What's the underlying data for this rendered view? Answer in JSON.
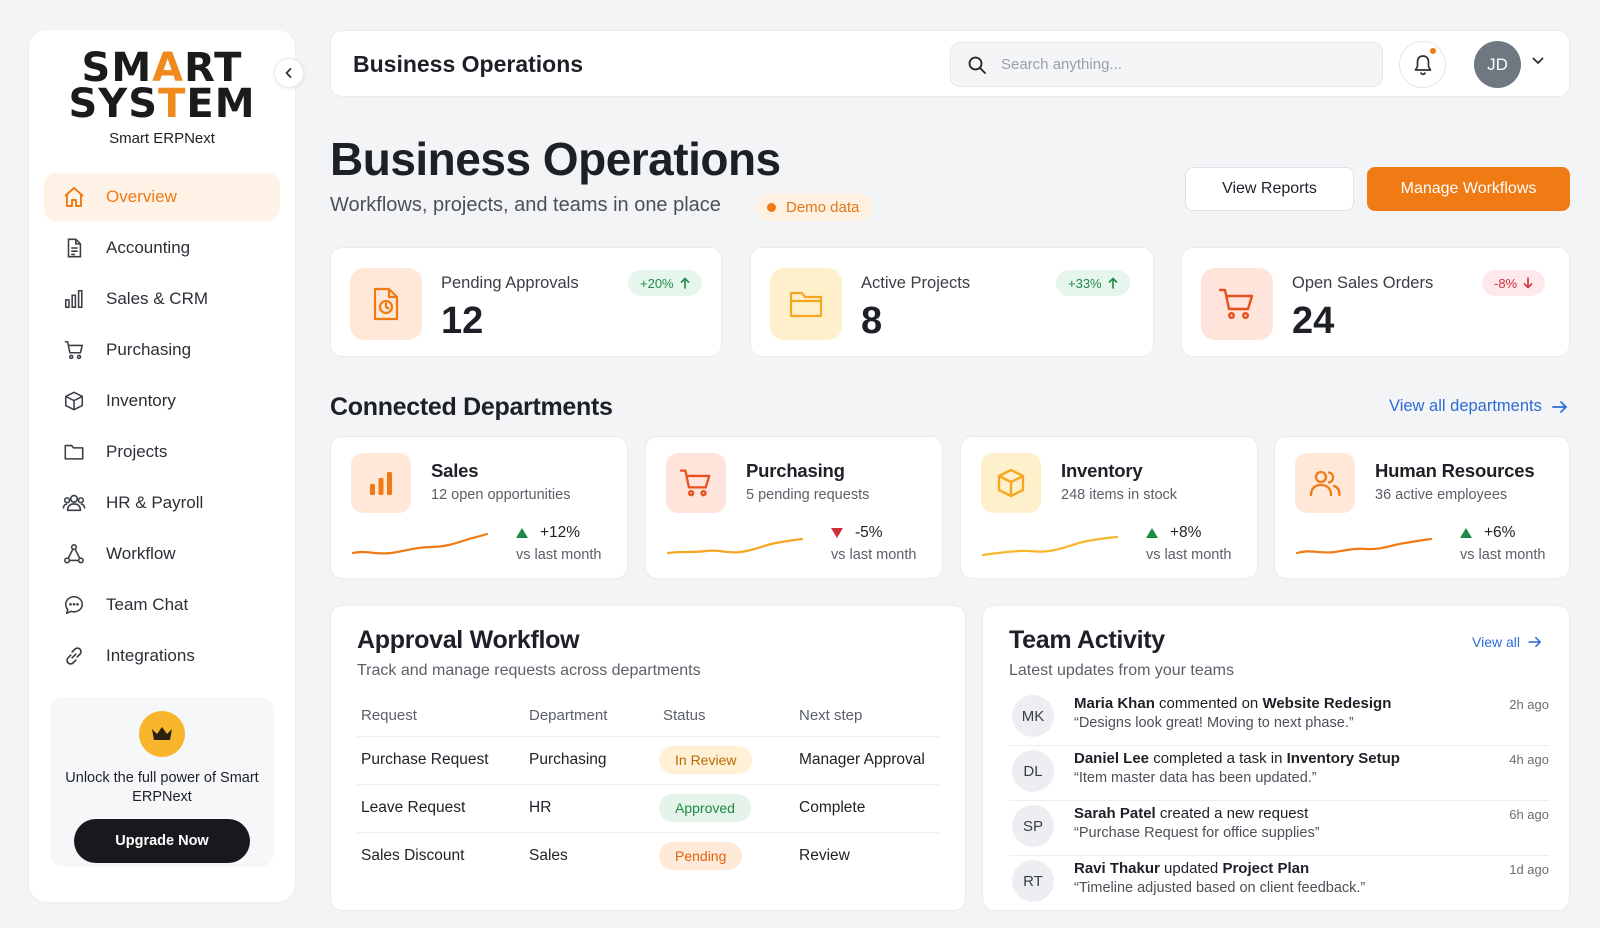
{
  "brand": {
    "logo_text": "SMART SYSTEM",
    "sub": "Smart ERPNext",
    "accent": "#f07a13"
  },
  "sidebar": {
    "items": [
      {
        "label": "Overview",
        "icon": "home-icon",
        "active": true
      },
      {
        "label": "Accounting",
        "icon": "document-icon"
      },
      {
        "label": "Sales & CRM",
        "icon": "bar-chart-icon"
      },
      {
        "label": "Purchasing",
        "icon": "cart-icon"
      },
      {
        "label": "Inventory",
        "icon": "box-icon"
      },
      {
        "label": "Projects",
        "icon": "folder-icon"
      },
      {
        "label": "HR & Payroll",
        "icon": "users-icon"
      },
      {
        "label": "Workflow",
        "icon": "workflow-icon"
      },
      {
        "label": "Team Chat",
        "icon": "chat-icon"
      },
      {
        "label": "Integrations",
        "icon": "link-icon"
      }
    ],
    "upgrade": {
      "text": "Unlock the full power of Smart ERPNext",
      "button": "Upgrade Now"
    }
  },
  "topbar": {
    "title": "Business Operations",
    "search_placeholder": "Search anything...",
    "avatar_initials": "JD"
  },
  "header": {
    "title": "Business Operations",
    "subtitle": "Workflows, projects, and teams in one place",
    "badge": "Demo data",
    "view_reports": "View Reports",
    "manage_workflows": "Manage Workflows"
  },
  "stats": [
    {
      "label": "Pending Approvals",
      "value": "12",
      "change": "+20%",
      "direction": "up",
      "icon": "clock-document-icon"
    },
    {
      "label": "Active Projects",
      "value": "8",
      "change": "+33%",
      "direction": "up",
      "icon": "folder-icon"
    },
    {
      "label": "Open Sales Orders",
      "value": "24",
      "change": "-8%",
      "direction": "down",
      "icon": "cart-icon"
    }
  ],
  "departments": {
    "title": "Connected Departments",
    "view_all": "View all departments",
    "items": [
      {
        "name": "Sales",
        "sub": "12 open opportunities",
        "change": "+12%",
        "direction": "up",
        "vs": "vs last month",
        "icon": "bar-chart-icon"
      },
      {
        "name": "Purchasing",
        "sub": "5 pending requests",
        "change": "-5%",
        "direction": "down",
        "vs": "vs last month",
        "icon": "cart-icon"
      },
      {
        "name": "Inventory",
        "sub": "248 items in stock",
        "change": "+8%",
        "direction": "up",
        "vs": "vs last month",
        "icon": "box-icon"
      },
      {
        "name": "Human Resources",
        "sub": "36 active employees",
        "change": "+6%",
        "direction": "up",
        "vs": "vs last month",
        "icon": "users-icon"
      }
    ]
  },
  "approval": {
    "title": "Approval Workflow",
    "subtitle": "Track and manage requests across departments",
    "columns": [
      "Request",
      "Department",
      "Status",
      "Next step"
    ],
    "rows": [
      {
        "request": "Purchase Request",
        "department": "Purchasing",
        "status": "In Review",
        "status_kind": "review",
        "next": "Manager Approval"
      },
      {
        "request": "Leave Request",
        "department": "HR",
        "status": "Approved",
        "status_kind": "approved",
        "next": "Complete"
      },
      {
        "request": "Sales Discount",
        "department": "Sales",
        "status": "Pending",
        "status_kind": "pending",
        "next": "Review"
      }
    ]
  },
  "activity": {
    "title": "Team Activity",
    "subtitle": "Latest updates from your teams",
    "view_all": "View all",
    "items": [
      {
        "initials": "MK",
        "name": "Maria Khan",
        "verb": "commented on",
        "target": "Website Redesign",
        "quote": "“Designs look great! Moving to next phase.”",
        "time": "2h ago"
      },
      {
        "initials": "DL",
        "name": "Daniel Lee",
        "verb": "completed a task in",
        "target": "Inventory Setup",
        "quote": "“Item master data has been updated.”",
        "time": "4h ago"
      },
      {
        "initials": "SP",
        "name": "Sarah Patel",
        "verb": "created a new request",
        "target": "",
        "quote": "“Purchase Request for office supplies”",
        "time": "6h ago"
      },
      {
        "initials": "RT",
        "name": "Ravi Thakur",
        "verb": "updated",
        "target": "Project Plan",
        "quote": "“Timeline adjusted based on client feedback.”",
        "time": "1d ago"
      }
    ]
  }
}
